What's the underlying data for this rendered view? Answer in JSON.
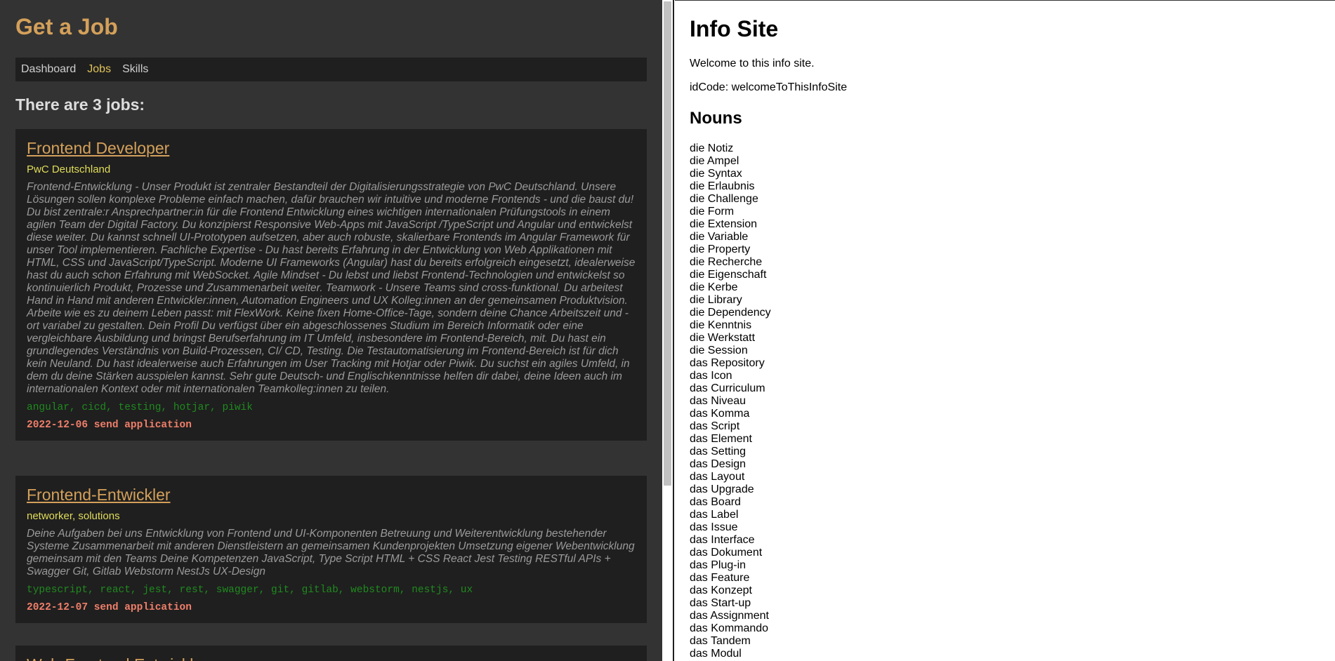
{
  "left": {
    "title": "Get a Job",
    "nav": [
      "Dashboard",
      "Jobs",
      "Skills"
    ],
    "jobs_heading": "There are 3 jobs:",
    "jobs": [
      {
        "title": "Frontend Developer",
        "company": "PwC Deutschland",
        "description": "Frontend-Entwicklung - Unser Produkt ist zentraler Bestandteil der Digitalisierungsstrategie von PwC Deutschland. Unsere Lösungen sollen komplexe Probleme einfach machen, dafür brauchen wir intuitive und moderne Frontends - und die baust du! Du bist zentrale:r Ansprechpartner:in für die Frontend Entwicklung eines wichtigen internationalen Prüfungstools in einem agilen Team der Digital Factory. Du konzipierst Responsive Web-Apps mit JavaScript /TypeScript und Angular und entwickelst diese weiter. Du kannst schnell UI-Prototypen aufsetzen, aber auch robuste, skalierbare Frontends im Angular Framework für unser Tool implementieren. Fachliche Expertise - Du hast bereits Erfahrung in der Entwicklung von Web Applikationen mit HTML, CSS und JavaScript/TypeScript. Moderne UI Frameworks (Angular) hast du bereits erfolgreich eingesetzt, idealerweise hast du auch schon Erfahrung mit WebSocket. Agile Mindset - Du lebst und liebst Frontend-Technologien und entwickelst so kontinuierlich Produkt, Prozesse und Zusammenarbeit weiter. Teamwork - Unsere Teams sind cross-funktional. Du arbeitest Hand in Hand mit anderen Entwickler:innen, Automation Engineers und UX Kolleg:innen an der gemeinsamen Produktvision. Arbeite wie es zu deinem Leben passt: mit FlexWork. Keine fixen Home-Office-Tage, sondern deine Chance Arbeitszeit und -ort variabel zu gestalten. Dein Profil Du verfügst über ein abgeschlossenes Studium im Bereich Informatik oder eine vergleichbare Ausbildung und bringst Berufserfahrung im IT Umfeld, insbesondere im Frontend-Bereich, mit. Du hast ein grundlegendes Verständnis von Build-Prozessen, CI/ CD, Testing. Die Testautomatisierung im Frontend-Bereich ist für dich kein Neuland. Du hast idealerweise auch Erfahrungen im User Tracking mit Hotjar oder Piwik. Du suchst ein agiles Umfeld, in dem du deine Stärken ausspielen kannst. Sehr gute Deutsch- und Englischkenntnisse helfen dir dabei, deine Ideen auch im internationalen Kontext oder mit internationalen Teamkolleg:innen zu teilen.",
        "tags": "angular, cicd, testing, hotjar, piwik",
        "status": "2022-12-06 send application"
      },
      {
        "title": "Frontend-Entwickler",
        "company": "networker, solutions",
        "description": "Deine Aufgaben bei uns Entwicklung von Frontend und UI-Komponenten Betreuung und Weiterentwicklung bestehender Systeme Zusammenarbeit mit anderen Dienstleistern an gemeinsamen Kundenprojekten Umsetzung eigener Webentwicklung gemeinsam mit den Teams Deine Kompetenzen JavaScript, Type Script HTML + CSS React Jest Testing RESTful APIs + Swagger Git, Gitlab Webstorm NestJs UX-Design",
        "tags": "typescript, react, jest, rest, swagger, git, gitlab, webstorm, nestjs, ux",
        "status": "2022-12-07 send application"
      }
    ],
    "partial_job_title": "Web-Frontend Entwickler"
  },
  "right": {
    "title": "Info Site",
    "welcome": "Welcome to this info site.",
    "id_code": "idCode: welcomeToThisInfoSite",
    "nouns_heading": "Nouns",
    "nouns": [
      "die Notiz",
      "die Ampel",
      "die Syntax",
      "die Erlaubnis",
      "die Challenge",
      "die Form",
      "die Extension",
      "die Variable",
      "die Property",
      "die Recherche",
      "die Eigenschaft",
      "die Kerbe",
      "die Library",
      "die Dependency",
      "die Kenntnis",
      "die Werkstatt",
      "die Session",
      "das Repository",
      "das Icon",
      "das Curriculum",
      "das Niveau",
      "das Komma",
      "das Script",
      "das Element",
      "das Setting",
      "das Design",
      "das Layout",
      "das Upgrade",
      "das Board",
      "das Label",
      "das Issue",
      "das Interface",
      "das Dokument",
      "das Plug-in",
      "das Feature",
      "das Konzept",
      "das Start-up",
      "das Assignment",
      "das Kommando",
      "das Tandem",
      "das Modul"
    ]
  }
}
